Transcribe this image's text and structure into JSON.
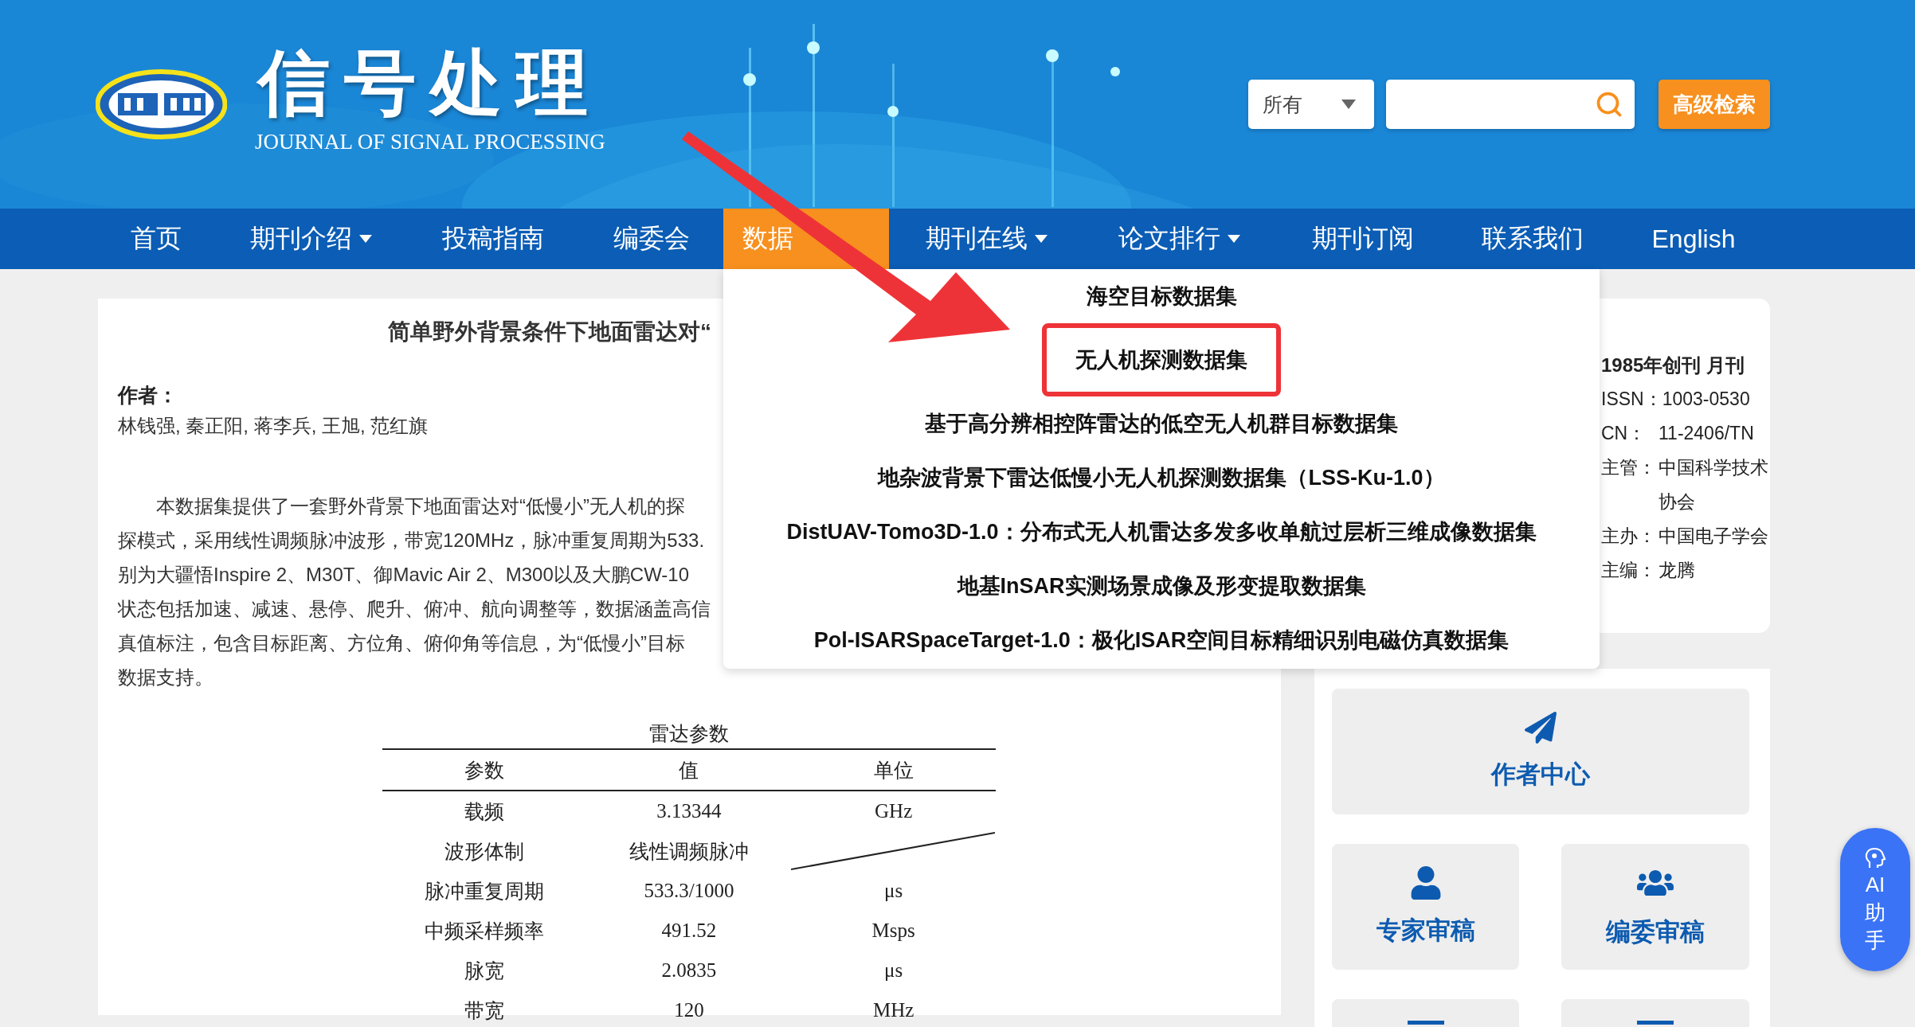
{
  "header": {
    "journal_title": "信号处理",
    "journal_subtitle": "JOURNAL OF SIGNAL PROCESSING",
    "search": {
      "scope": "所有",
      "advanced_button": "高级检索"
    }
  },
  "nav": [
    {
      "label": "首页",
      "selected": false,
      "has_menu": false
    },
    {
      "label": "期刊介绍",
      "selected": false,
      "has_menu": true
    },
    {
      "label": "投稿指南",
      "selected": false,
      "has_menu": false
    },
    {
      "label": "编委会",
      "selected": false,
      "has_menu": false
    },
    {
      "label": "数据",
      "selected": true,
      "has_menu": false
    },
    {
      "label": "期刊在线",
      "selected": false,
      "has_menu": true
    },
    {
      "label": "论文排行",
      "selected": false,
      "has_menu": true
    },
    {
      "label": "期刊订阅",
      "selected": false,
      "has_menu": false
    },
    {
      "label": "联系我们",
      "selected": false,
      "has_menu": false
    },
    {
      "label": "English",
      "selected": false,
      "has_menu": false
    }
  ],
  "dropdown": {
    "items": [
      {
        "label": "海空目标数据集",
        "highlighted": false
      },
      {
        "label": "无人机探测数据集",
        "highlighted": true
      },
      {
        "label": "基于高分辨相控阵雷达的低空无人机群目标数据集",
        "highlighted": false
      },
      {
        "label": "地杂波背景下雷达低慢小无人机探测数据集（LSS-Ku-1.0）",
        "highlighted": false
      },
      {
        "label": "DistUAV-Tomo3D-1.0：分布式无人机雷达多发多收单航过层析三维成像数据集",
        "highlighted": false
      },
      {
        "label": "地基InSAR实测场景成像及形变提取数据集",
        "highlighted": false
      },
      {
        "label": "Pol-ISARSpaceTarget-1.0：极化ISAR空间目标精细识别电磁仿真数据集",
        "highlighted": false
      }
    ]
  },
  "article": {
    "title": "简单野外背景条件下地面雷达对“",
    "author_label": "作者：",
    "authors": "林钱强, 秦正阳, 蒋李兵, 王旭, 范红旗",
    "paragraph_lines": [
      "本数据集提供了一套野外背景下地面雷达对“低慢小”无人机的探",
      "探模式，采用线性调频脉冲波形，带宽120MHz，脉冲重复周期为533.",
      "别为大疆悟Inspire 2、M30T、御Mavic Air 2、M300以及大鹏CW-10",
      "状态包括加速、减速、悬停、爬升、俯冲、航向调整等，数据涵盖高信",
      "真值标注，包含目标距离、方位角、俯仰角等信息，为“低慢小”目标",
      "数据支持。"
    ],
    "table": {
      "caption": "雷达参数",
      "columns": [
        "参数",
        "值",
        "单位"
      ],
      "rows": [
        {
          "param": "载频",
          "value": "3.13344",
          "unit": "GHz"
        },
        {
          "param": "波形体制",
          "value": "线性调频脉冲"
        },
        {
          "param": "脉冲重复周期",
          "value": "533.3/1000",
          "unit": "μs"
        },
        {
          "param": "中频采样频率",
          "value": "491.52",
          "unit": "Msps"
        },
        {
          "param": "脉宽",
          "value": "2.0835",
          "unit": "μs"
        },
        {
          "param": "带宽",
          "value": "120",
          "unit": "MHz"
        }
      ]
    }
  },
  "sidebar": {
    "founded": "1985年创刊 月刊",
    "info": [
      {
        "label": "ISSN：",
        "value": "1003-0530"
      },
      {
        "label": "CN：",
        "value": "11-2406/TN"
      },
      {
        "label": "主管：",
        "value": "中国科学技术协会"
      },
      {
        "label": "主办：",
        "value": "中国电子学会"
      },
      {
        "label": "主编：",
        "value": "龙腾"
      }
    ],
    "buttons": [
      {
        "label": "作者中心",
        "kind": "plane"
      },
      {
        "label": "专家审稿",
        "kind": "user"
      },
      {
        "label": "编委审稿",
        "kind": "users"
      },
      {
        "kind": "bar"
      },
      {
        "kind": "bar"
      }
    ]
  },
  "ai_button": {
    "lines": [
      "AI",
      "助",
      "手"
    ]
  }
}
